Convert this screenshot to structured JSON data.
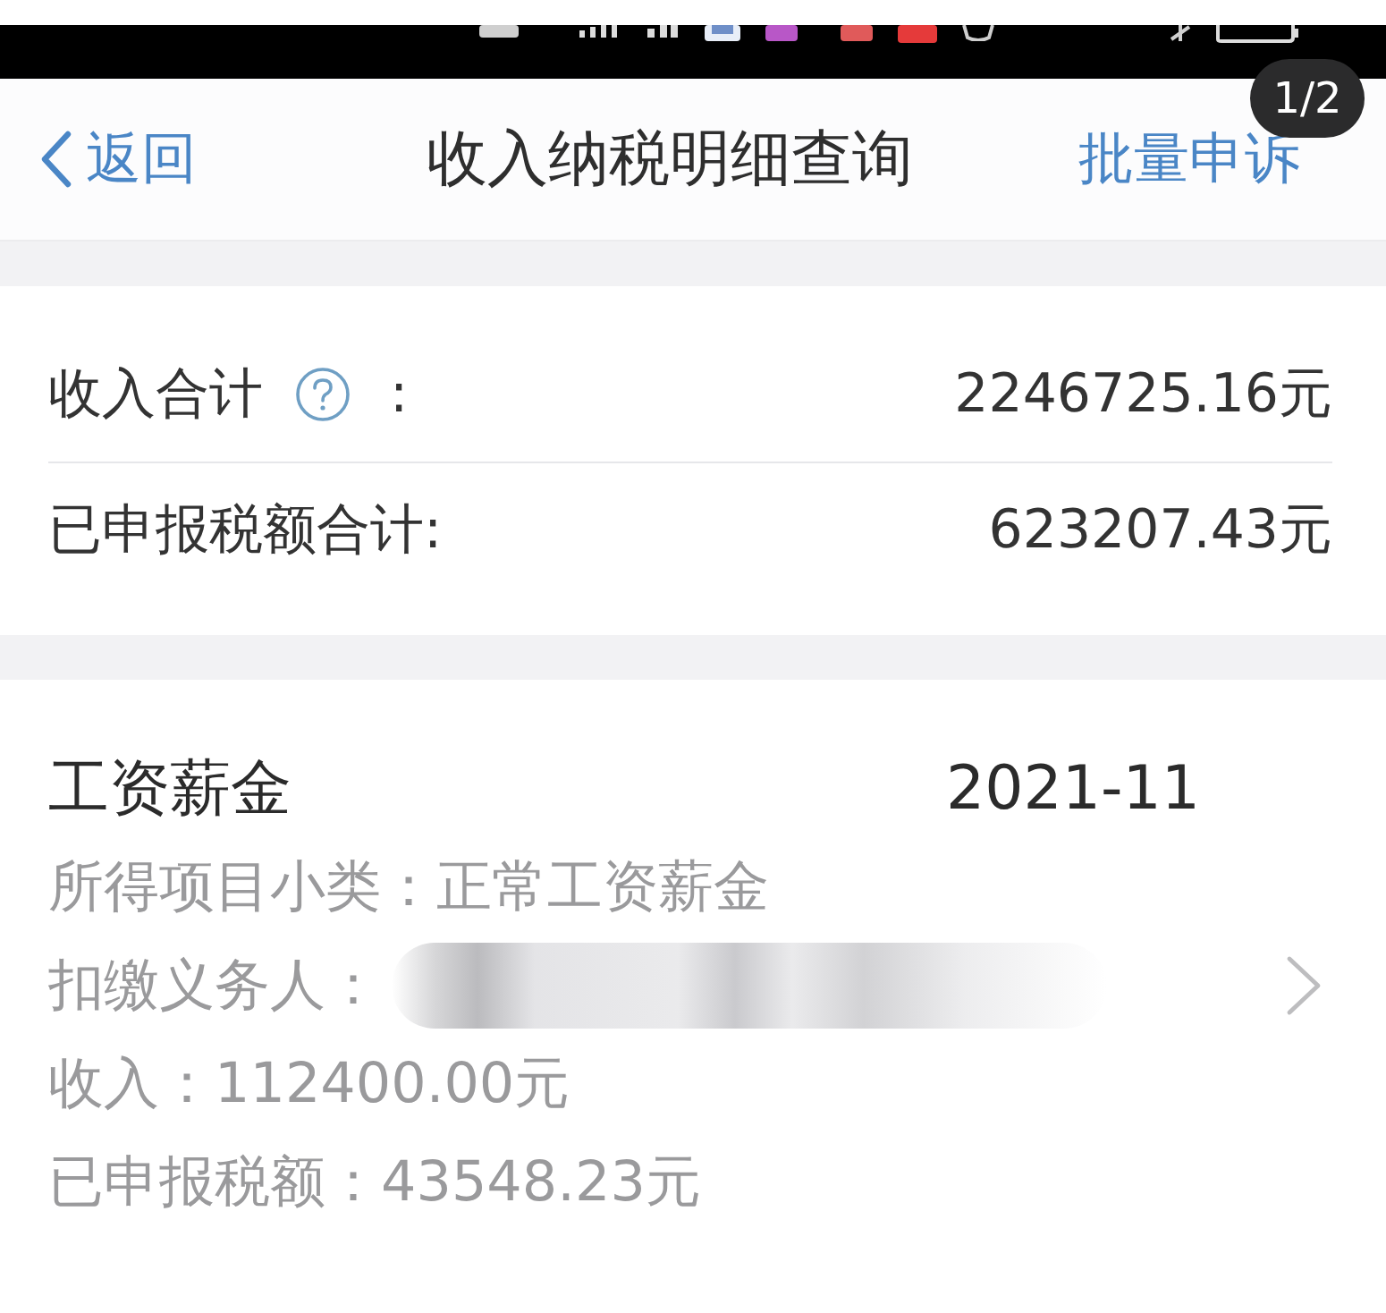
{
  "page_indicator": "1/2",
  "nav_bar": {
    "back_label": "返回",
    "title": "收入纳税明细查询",
    "action": "批量申诉"
  },
  "summary": {
    "rows": [
      {
        "label": "收入合计",
        "help_icon": true,
        "colon": ":",
        "value": "2246725.16元"
      },
      {
        "label": "已申报税额合计:",
        "help_icon": false,
        "value": "623207.43元"
      }
    ]
  },
  "records": [
    {
      "category": "工资薪金",
      "period": "2021-11",
      "fields": [
        {
          "label": "所得项目小类：",
          "value": "正常工资薪金"
        },
        {
          "label": "扣缴义务人：",
          "redacted": true
        },
        {
          "label": "收入：",
          "value": "112400.00元"
        },
        {
          "label": "已申报税额：",
          "value": "43548.23元"
        }
      ]
    }
  ]
}
